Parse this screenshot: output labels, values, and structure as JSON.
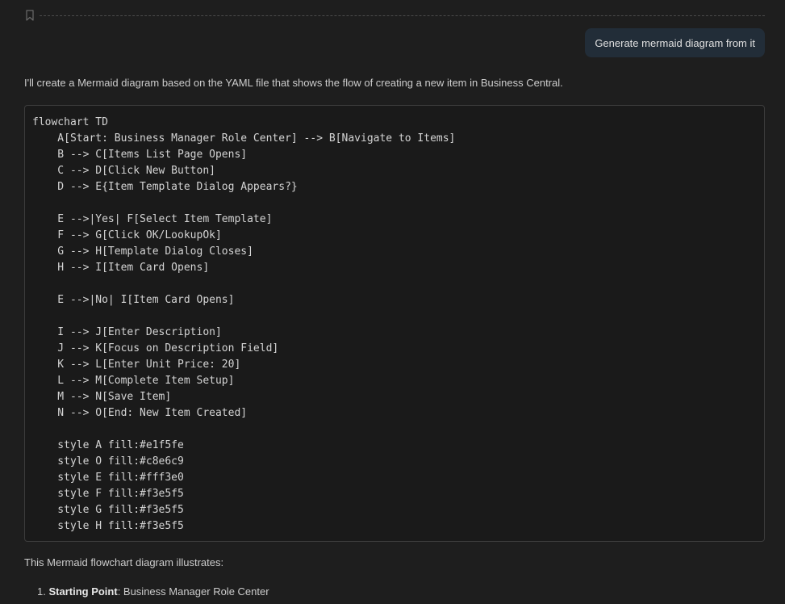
{
  "chat": {
    "user_message": "Generate mermaid diagram from it",
    "assistant_intro": "I'll create a Mermaid diagram based on the YAML file that shows the flow of creating a new item in Business Central.",
    "code_lines": [
      "flowchart TD",
      "    A[Start: Business Manager Role Center] --> B[Navigate to Items]",
      "    B --> C[Items List Page Opens]",
      "    C --> D[Click New Button]",
      "    D --> E{Item Template Dialog Appears?}",
      "",
      "    E -->|Yes| F[Select Item Template]",
      "    F --> G[Click OK/LookupOk]",
      "    G --> H[Template Dialog Closes]",
      "    H --> I[Item Card Opens]",
      "",
      "    E -->|No| I[Item Card Opens]",
      "",
      "    I --> J[Enter Description]",
      "    J --> K[Focus on Description Field]",
      "    K --> L[Enter Unit Price: 20]",
      "    L --> M[Complete Item Setup]",
      "    M --> N[Save Item]",
      "    N --> O[End: New Item Created]",
      "",
      "    style A fill:#e1f5fe",
      "    style O fill:#c8e6c9",
      "    style E fill:#fff3e0",
      "    style F fill:#f3e5f5",
      "    style G fill:#f3e5f5",
      "    style H fill:#f3e5f5"
    ],
    "summary": "This Mermaid flowchart diagram illustrates:",
    "list": [
      {
        "number": "1.",
        "bold": "Starting Point",
        "text": ": Business Manager Role Center"
      }
    ]
  },
  "colors": {
    "background": "#1e1e1e",
    "user_bubble": "#222d38",
    "code_background": "#1a1a1a"
  },
  "icons": {
    "bookmark": "bookmark-icon"
  }
}
